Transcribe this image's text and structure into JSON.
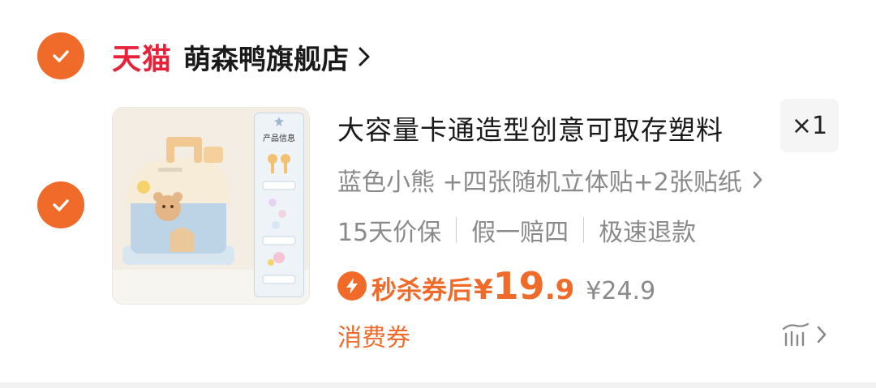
{
  "store": {
    "brand_logo_text": "天猫",
    "name": "萌森鸭旗舰店"
  },
  "product": {
    "title": "大容量卡通造型创意可取存塑料",
    "quantity": "×1",
    "variant": "蓝色小熊 +四张随机立体贴+2张贴纸",
    "services": [
      "15天价保",
      "假一赔四",
      "极速退款"
    ],
    "image_info_title": "产品信息",
    "promo_label": "秒杀券后",
    "currency": "¥",
    "price_integer": "19",
    "price_decimal": ".9",
    "original_price": "¥24.9",
    "coupon_label": "消费券"
  },
  "colors": {
    "accent": "#f06a2a",
    "tmall_red": "#e8223a"
  },
  "icons": {
    "store_check": "check-icon",
    "item_check": "check-icon",
    "promo": "lightning-icon",
    "more": "price-trend-icon"
  }
}
